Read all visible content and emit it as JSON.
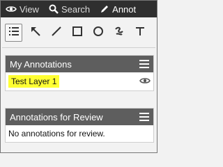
{
  "nav": {
    "items": [
      {
        "label": "View",
        "icon": "eye-icon"
      },
      {
        "label": "Search",
        "icon": "search-icon"
      },
      {
        "label": "Annot",
        "icon": "pencil-icon"
      }
    ]
  },
  "toolbar": {
    "tools": [
      "list-icon",
      "arrow-icon",
      "line-icon",
      "rectangle-icon",
      "circle-icon",
      "freehand-icon",
      "text-icon"
    ]
  },
  "my_annotations": {
    "title": "My Annotations",
    "layer_name": "Test Layer 1",
    "highlight": "#ffff33"
  },
  "review": {
    "title": "Annotations for Review",
    "empty_text": "No annotations for review."
  }
}
